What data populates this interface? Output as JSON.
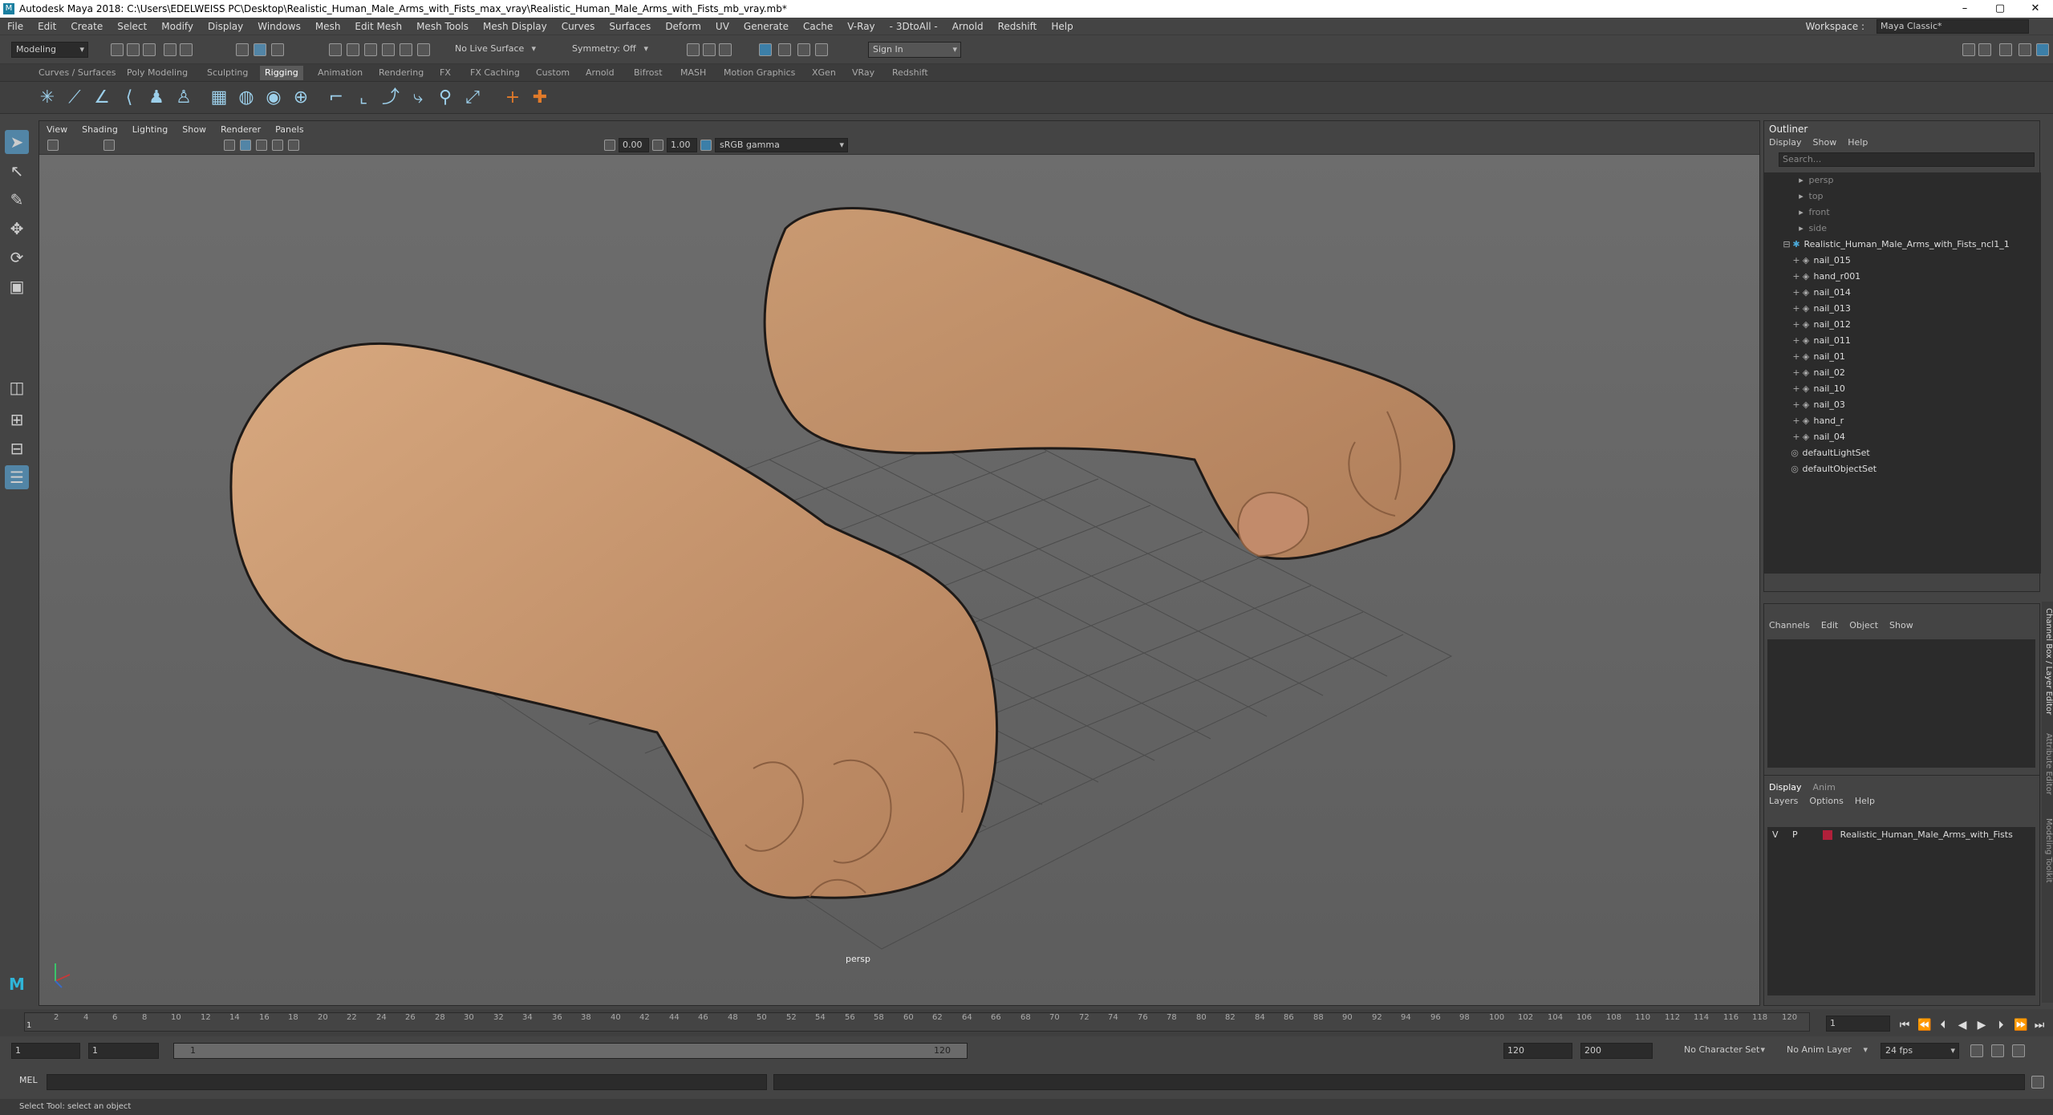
{
  "title_bar": {
    "title": "Autodesk Maya 2018: C:\\Users\\EDELWEISS PC\\Desktop\\Realistic_Human_Male_Arms_with_Fists_max_vray\\Realistic_Human_Male_Arms_with_Fists_mb_vray.mb*",
    "minimize": "–",
    "maximize": "▢",
    "close": "✕"
  },
  "menu": [
    "File",
    "Edit",
    "Create",
    "Select",
    "Modify",
    "Display",
    "Windows",
    "Mesh",
    "Edit Mesh",
    "Mesh Tools",
    "Mesh Display",
    "Curves",
    "Surfaces",
    "Deform",
    "UV",
    "Generate",
    "Cache",
    "V-Ray",
    "- 3DtoAll -",
    "Arnold",
    "Redshift",
    "Help"
  ],
  "workspace": {
    "label": "Workspace :",
    "value": "Maya Classic*"
  },
  "status": {
    "mode": "Modeling",
    "live_surface": "No Live Surface",
    "symmetry": "Symmetry: Off",
    "sign_in": "Sign In"
  },
  "shelf_tabs": [
    "Curves / Surfaces",
    "Poly Modeling",
    "Sculpting",
    "Rigging",
    "Animation",
    "Rendering",
    "FX",
    "FX Caching",
    "Custom",
    "Arnold",
    "Bifrost",
    "MASH",
    "Motion Graphics",
    "XGen",
    "VRay",
    "Redshift"
  ],
  "active_shelf": "Rigging",
  "viewport": {
    "menu": [
      "View",
      "Shading",
      "Lighting",
      "Show",
      "Renderer",
      "Panels"
    ],
    "exposure": "0.00",
    "gamma": "1.00",
    "color_space": "sRGB gamma",
    "camera_label": "persp"
  },
  "outliner": {
    "title": "Outliner",
    "menu": [
      "Display",
      "Show",
      "Help"
    ],
    "search_placeholder": "Search...",
    "cameras": [
      "persp",
      "top",
      "front",
      "side"
    ],
    "group": "Realistic_Human_Male_Arms_with_Fists_ncl1_1",
    "children": [
      "nail_015",
      "hand_r001",
      "nail_014",
      "nail_013",
      "nail_012",
      "nail_011",
      "nail_01",
      "nail_02",
      "nail_10",
      "nail_03",
      "hand_r",
      "nail_04"
    ],
    "sets": [
      "defaultLightSet",
      "defaultObjectSet"
    ]
  },
  "channel_box": {
    "menu": [
      "Channels",
      "Edit",
      "Object",
      "Show"
    ]
  },
  "layer_editor": {
    "tabs": [
      "Display",
      "Anim"
    ],
    "menu": [
      "Layers",
      "Options",
      "Help"
    ],
    "layer": {
      "v": "V",
      "p": "P",
      "name": "Realistic_Human_Male_Arms_with_Fists",
      "color": "#b0203a"
    }
  },
  "side_tabs": [
    "Channel Box / Layer Editor",
    "Attribute Editor",
    "Modeling Toolkit"
  ],
  "timeline": {
    "ticks": [
      "2",
      "4",
      "6",
      "8",
      "10",
      "12",
      "14",
      "16",
      "18",
      "20",
      "22",
      "24",
      "26",
      "28",
      "30",
      "32",
      "34",
      "36",
      "38",
      "40",
      "42",
      "44",
      "46",
      "48",
      "50",
      "52",
      "54",
      "56",
      "58",
      "60",
      "62",
      "64",
      "66",
      "68",
      "70",
      "72",
      "74",
      "76",
      "78",
      "80",
      "82",
      "84",
      "86",
      "88",
      "90",
      "92",
      "94",
      "96",
      "98",
      "100",
      "102",
      "104",
      "106",
      "108",
      "110",
      "112",
      "114",
      "116",
      "118",
      "120"
    ],
    "current_frame": "1",
    "start_label": "1"
  },
  "range": {
    "start": "1",
    "playback_start": "1",
    "slider_start": "1",
    "slider_end": "120",
    "end": "120",
    "anim_end": "200",
    "character_set": "No Character Set",
    "anim_layer": "No Anim Layer",
    "fps": "24 fps"
  },
  "command": {
    "lang": "MEL"
  },
  "help_line": "Select Tool: select an object"
}
